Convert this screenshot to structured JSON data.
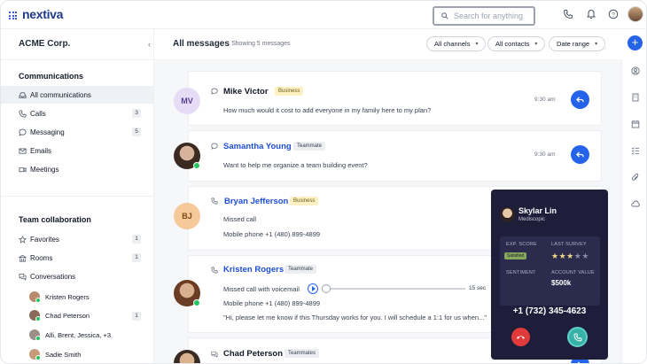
{
  "brand": {
    "logo": "nextiva"
  },
  "search": {
    "placeholder": "Search for anything"
  },
  "sidebar": {
    "company": "ACME Corp.",
    "communications_title": "Communications",
    "items": [
      {
        "label": "All communications",
        "count": ""
      },
      {
        "label": "Calls",
        "count": "3"
      },
      {
        "label": "Messaging",
        "count": "5"
      },
      {
        "label": "Emails",
        "count": ""
      },
      {
        "label": "Meetings",
        "count": ""
      }
    ],
    "team_title": "Team collaboration",
    "team_items": [
      {
        "label": "Favorites",
        "count": "1"
      },
      {
        "label": "Rooms",
        "count": "1"
      },
      {
        "label": "Conversations",
        "count": ""
      }
    ],
    "conversations": [
      {
        "label": "Kristen Rogers",
        "count": ""
      },
      {
        "label": "Chad Peterson",
        "count": "1"
      },
      {
        "label": "Alli, Brent, Jessica, +3",
        "count": ""
      },
      {
        "label": "Sadie Smith",
        "count": ""
      }
    ]
  },
  "main": {
    "title": "All messages",
    "subtitle": "Showing 5 messages",
    "filters": [
      "All channels",
      "All contacts",
      "Date range"
    ]
  },
  "messages": [
    {
      "initials": "MV",
      "name": "Mike Victor",
      "tag": "Business",
      "lines": [
        "How much would it cost to add everyone in my family here to my plan?"
      ],
      "time": "9:30 am"
    },
    {
      "initials": "",
      "name": "Samantha Young",
      "tag": "Teammate",
      "lines": [
        "Want to help me organize a team building event?"
      ],
      "time": "9:30 am"
    },
    {
      "initials": "BJ",
      "name": "Bryan Jefferson",
      "tag": "Business",
      "lines": [
        "Missed call",
        "Mobile phone +1 (480) 899-4899"
      ],
      "time": ""
    },
    {
      "initials": "",
      "name": "Kristen Rogers",
      "tag": "Teammate",
      "lines": [
        "Missed call with voicemail",
        "Mobile phone +1 (480) 899-4899",
        "\"Hi, please let me know if this Thursday works for you. I will schedule a 1:1 for us when...\""
      ],
      "duration": "15 sec"
    },
    {
      "initials": "",
      "name": "Chad Peterson",
      "tag": "Teammates",
      "lines": []
    }
  ],
  "call_popup": {
    "name": "Skylar Lin",
    "company": "Mediscopic",
    "exp_score_label": "EXP. SCORE",
    "exp_score_value": "Satisfied",
    "last_survey_label": "LAST SURVEY",
    "stars_filled": 3,
    "stars_total": 5,
    "sentiment_label": "SENTIMENT",
    "account_value_label": "ACCOUNT VALUE",
    "account_value": "$500k",
    "phone": "+1 (732) 345-4623"
  },
  "colors": {
    "accent": "#2563eb",
    "popup_bg": "#1e1e3a",
    "decline": "#e03a3a",
    "answer": "#38b2a7"
  }
}
